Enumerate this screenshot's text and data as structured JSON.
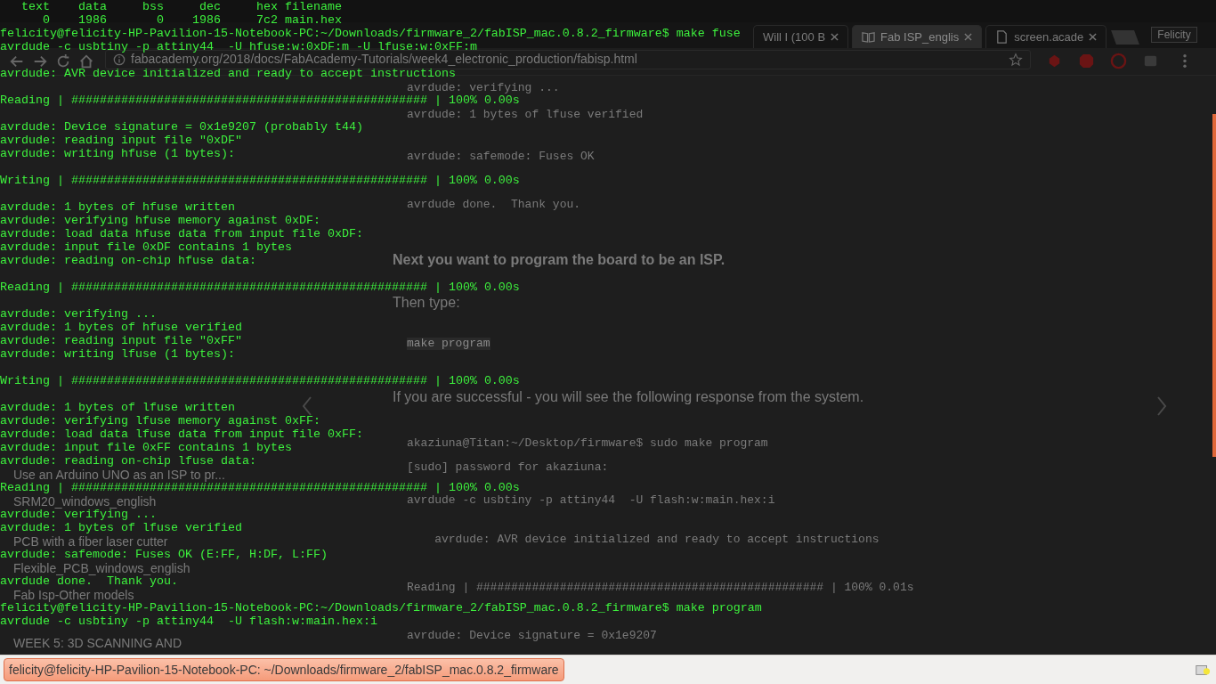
{
  "terminal": {
    "lines": [
      {
        "kind": "text",
        "text": "   text    data     bss     dec     hex filename"
      },
      {
        "kind": "text",
        "text": "      0    1986       0    1986     7c2 main.hex"
      },
      {
        "kind": "text",
        "text": "felicity@felicity-HP-Pavilion-15-Notebook-PC:~/Downloads/firmware_2/fabISP_mac.0.8.2_firmware$ make fuse"
      },
      {
        "kind": "text",
        "text": "avrdude -c usbtiny -p attiny44  -U hfuse:w:0xDF:m -U lfuse:w:0xFF:m"
      },
      {
        "kind": "blank"
      },
      {
        "kind": "text",
        "text": "avrdude: AVR device initialized and ready to accept instructions"
      },
      {
        "kind": "blank"
      },
      {
        "kind": "text",
        "text": "Reading | ################################################## | 100% 0.00s"
      },
      {
        "kind": "blank"
      },
      {
        "kind": "text",
        "text": "avrdude: Device signature = 0x1e9207 (probably t44)"
      },
      {
        "kind": "text",
        "text": "avrdude: reading input file \"0xDF\""
      },
      {
        "kind": "text",
        "text": "avrdude: writing hfuse (1 bytes):"
      },
      {
        "kind": "blank"
      },
      {
        "kind": "text",
        "text": "Writing | ################################################## | 100% 0.00s"
      },
      {
        "kind": "blank"
      },
      {
        "kind": "text",
        "text": "avrdude: 1 bytes of hfuse written"
      },
      {
        "kind": "text",
        "text": "avrdude: verifying hfuse memory against 0xDF:"
      },
      {
        "kind": "text",
        "text": "avrdude: load data hfuse data from input file 0xDF:"
      },
      {
        "kind": "text",
        "text": "avrdude: input file 0xDF contains 1 bytes"
      },
      {
        "kind": "text",
        "text": "avrdude: reading on-chip hfuse data:"
      },
      {
        "kind": "blank"
      },
      {
        "kind": "text",
        "text": "Reading | ################################################## | 100% 0.00s"
      },
      {
        "kind": "blank"
      },
      {
        "kind": "text",
        "text": "avrdude: verifying ..."
      },
      {
        "kind": "text",
        "text": "avrdude: 1 bytes of hfuse verified"
      },
      {
        "kind": "text",
        "text": "avrdude: reading input file \"0xFF\""
      },
      {
        "kind": "text",
        "text": "avrdude: writing lfuse (1 bytes):"
      },
      {
        "kind": "blank"
      },
      {
        "kind": "text",
        "text": "Writing | ################################################## | 100% 0.00s"
      },
      {
        "kind": "blank"
      },
      {
        "kind": "text",
        "text": "avrdude: 1 bytes of lfuse written"
      },
      {
        "kind": "text",
        "text": "avrdude: verifying lfuse memory against 0xFF:"
      },
      {
        "kind": "text",
        "text": "avrdude: load data lfuse data from input file 0xFF:"
      },
      {
        "kind": "text",
        "text": "avrdude: input file 0xFF contains 1 bytes"
      },
      {
        "kind": "text",
        "text": "avrdude: reading on-chip lfuse data:"
      },
      {
        "kind": "blank"
      },
      {
        "kind": "text",
        "text": "Reading | ################################################## | 100% 0.00s"
      },
      {
        "kind": "blank"
      },
      {
        "kind": "text",
        "text": "avrdude: verifying ..."
      },
      {
        "kind": "text",
        "text": "avrdude: 1 bytes of lfuse verified"
      },
      {
        "kind": "blank"
      },
      {
        "kind": "text",
        "text": "avrdude: safemode: Fuses OK (E:FF, H:DF, L:FF)"
      },
      {
        "kind": "blank"
      },
      {
        "kind": "text",
        "text": "avrdude done.  Thank you."
      },
      {
        "kind": "blank"
      },
      {
        "kind": "text",
        "text": "felicity@felicity-HP-Pavilion-15-Notebook-PC:~/Downloads/firmware_2/fabISP_mac.0.8.2_firmware$ make program"
      },
      {
        "kind": "text",
        "text": "avrdude -c usbtiny -p attiny44  -U flash:w:main.hex:i"
      }
    ]
  },
  "browser": {
    "tabs": [
      {
        "title": "Will I (100 B",
        "selected": false
      },
      {
        "title": "Fab ISP_englis",
        "selected": true
      },
      {
        "title": "screen.acade",
        "selected": false
      }
    ],
    "profile": "Felicity",
    "address": "fabacademy.org/2018/docs/FabAcademy-Tutorials/week4_electronic_production/fabisp.html",
    "sidebar": [
      {
        "kind": "link",
        "text": "Use an Arduino UNO as an ISP to pr..."
      },
      {
        "kind": "link",
        "text": "SRM20_windows_english"
      },
      {
        "kind": "link",
        "text": "PCB with a fiber laser cutter"
      },
      {
        "kind": "link",
        "text": "Flexible_PCB_windows_english"
      },
      {
        "kind": "link",
        "text": "Fab Isp-Other models"
      },
      {
        "kind": "heading",
        "text": "WEEK 5: 3D SCANNING AND"
      }
    ],
    "content": [
      {
        "kind": "code",
        "lines": [
          "avrdude: verifying ...",
          "avrdude: 1 bytes of lfuse verified"
        ]
      },
      {
        "kind": "code",
        "lines": [
          "avrdude: safemode: Fuses OK"
        ]
      },
      {
        "kind": "code",
        "lines": [
          "avrdude done.  Thank you."
        ]
      },
      {
        "kind": "heading",
        "text": "Next you want to program the board to be an ISP."
      },
      {
        "kind": "para",
        "text": "Then type:"
      },
      {
        "kind": "command",
        "text": "make program"
      },
      {
        "kind": "para",
        "text": "If you are successful - you will see the following response from the system."
      },
      {
        "kind": "code",
        "lines": [
          "akaziuna@Titan:~/Desktop/firmware$ sudo make program",
          "[sudo] password for akaziuna:",
          "avrdude -c usbtiny -p attiny44  -U flash:w:main.hex:i"
        ]
      },
      {
        "kind": "code",
        "lines": [
          "    avrdude: AVR device initialized and ready to accept instructions"
        ]
      },
      {
        "kind": "code",
        "lines": [
          "Reading | ################################################## | 100% 0.01s"
        ]
      },
      {
        "kind": "code",
        "lines": [
          "avrdude: Device signature = 0x1e9207"
        ]
      }
    ]
  },
  "taskbar": {
    "tasks": [
      {
        "title": "felicity@felicity-HP-Pavilion-15-Notebook-PC: ~/Downloads/firmware_2/fabISP_mac.0.8.2_firmware",
        "selected": true
      }
    ]
  }
}
